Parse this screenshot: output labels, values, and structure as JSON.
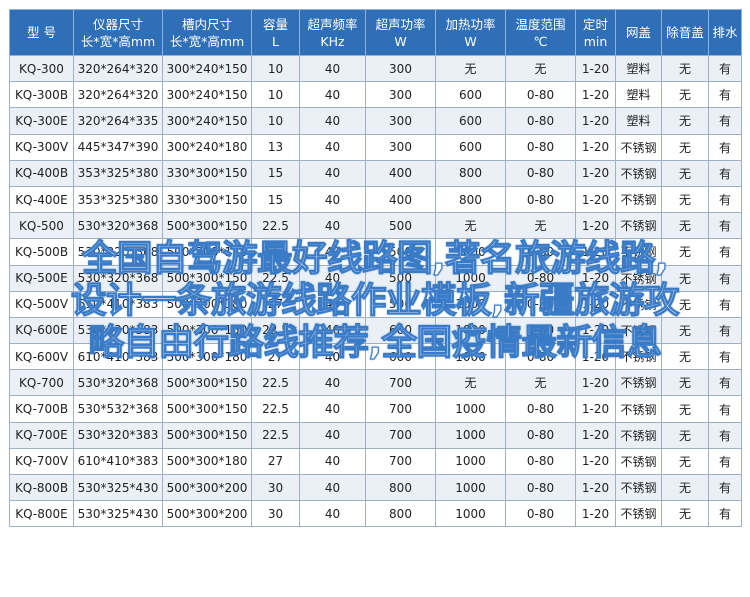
{
  "table": {
    "headers": [
      {
        "line1": "型 号",
        "line2": ""
      },
      {
        "line1": "仪器尺寸",
        "line2": "长*宽*高mm"
      },
      {
        "line1": "槽内尺寸",
        "line2": "长*宽*高mm"
      },
      {
        "line1": "容量",
        "line2": "L"
      },
      {
        "line1": "超声频率",
        "line2": "KHz"
      },
      {
        "line1": "超声功率",
        "line2": "W"
      },
      {
        "line1": "加热功率",
        "line2": "W"
      },
      {
        "line1": "温度范围",
        "line2": "℃"
      },
      {
        "line1": "定时",
        "line2": "min"
      },
      {
        "line1": "网盖",
        "line2": ""
      },
      {
        "line1": "除音盖",
        "line2": ""
      },
      {
        "line1": "排水",
        "line2": ""
      }
    ],
    "rows": [
      [
        "KQ-300",
        "320*264*320",
        "300*240*150",
        "10",
        "40",
        "300",
        "无",
        "无",
        "1-20",
        "塑料",
        "无",
        "有"
      ],
      [
        "KQ-300B",
        "320*264*320",
        "300*240*150",
        "10",
        "40",
        "300",
        "600",
        "0-80",
        "1-20",
        "塑料",
        "无",
        "有"
      ],
      [
        "KQ-300E",
        "320*264*335",
        "300*240*150",
        "10",
        "40",
        "300",
        "600",
        "0-80",
        "1-20",
        "塑料",
        "无",
        "有"
      ],
      [
        "KQ-300V",
        "445*347*390",
        "300*240*180",
        "13",
        "40",
        "300",
        "600",
        "0-80",
        "1-20",
        "不锈钢",
        "无",
        "有"
      ],
      [
        "KQ-400B",
        "353*325*380",
        "330*300*150",
        "15",
        "40",
        "400",
        "800",
        "0-80",
        "1-20",
        "不锈钢",
        "无",
        "有"
      ],
      [
        "KQ-400E",
        "353*325*380",
        "330*300*150",
        "15",
        "40",
        "400",
        "800",
        "0-80",
        "1-20",
        "不锈钢",
        "无",
        "有"
      ],
      [
        "KQ-500",
        "530*320*368",
        "500*300*150",
        "22.5",
        "40",
        "500",
        "无",
        "无",
        "1-20",
        "不锈钢",
        "无",
        "有"
      ],
      [
        "KQ-500B",
        "530*320*368",
        "500*300*150",
        "22.5",
        "40",
        "500",
        "1000",
        "0-80",
        "1-20",
        "不锈钢",
        "无",
        "有"
      ],
      [
        "KQ-500E",
        "530*320*368",
        "500*300*150",
        "22.5",
        "40",
        "500",
        "1000",
        "0-80",
        "1-20",
        "不锈钢",
        "无",
        "有"
      ],
      [
        "KQ-500V",
        "610*410*383",
        "500*300*180",
        "27",
        "40",
        "500",
        "1000",
        "0-80",
        "1-20",
        "不锈钢",
        "无",
        "有"
      ],
      [
        "KQ-600E",
        "530*530*383",
        "500*300*150",
        "22.5",
        "40",
        "600",
        "1000",
        "0-80",
        "1-20",
        "不锈钢",
        "无",
        "有"
      ],
      [
        "KQ-600V",
        "610*410*383",
        "500*300*180",
        "27",
        "40",
        "600",
        "1000",
        "0-80",
        "1-20",
        "不锈钢",
        "无",
        "有"
      ],
      [
        "KQ-700",
        "530*320*368",
        "500*300*150",
        "22.5",
        "40",
        "700",
        "无",
        "无",
        "1-20",
        "不锈钢",
        "无",
        "有"
      ],
      [
        "KQ-700B",
        "530*532*368",
        "500*300*150",
        "22.5",
        "40",
        "700",
        "1000",
        "0-80",
        "1-20",
        "不锈钢",
        "无",
        "有"
      ],
      [
        "KQ-700E",
        "530*320*383",
        "500*300*150",
        "22.5",
        "40",
        "700",
        "1000",
        "0-80",
        "1-20",
        "不锈钢",
        "无",
        "有"
      ],
      [
        "KQ-700V",
        "610*410*383",
        "500*300*180",
        "27",
        "40",
        "700",
        "1000",
        "0-80",
        "1-20",
        "不锈钢",
        "无",
        "有"
      ],
      [
        "KQ-800B",
        "530*325*430",
        "500*300*200",
        "30",
        "40",
        "800",
        "1000",
        "0-80",
        "1-20",
        "不锈钢",
        "无",
        "有"
      ],
      [
        "KQ-800E",
        "530*325*430",
        "500*300*200",
        "30",
        "40",
        "800",
        "1000",
        "0-80",
        "1-20",
        "不锈钢",
        "无",
        "有"
      ]
    ]
  },
  "overlay": {
    "lines": [
      "全国自驾游最好线路图,著名旅游线路,",
      "设计一条旅游线路作业模板,新疆旅游攻",
      "略自由行路线推荐,全国疫情最新信息"
    ]
  },
  "colors": {
    "header_bg": "#2e6fb8",
    "row_alt_bg": "#eaf0f6",
    "overlay_stroke": "#3a7bc8"
  }
}
